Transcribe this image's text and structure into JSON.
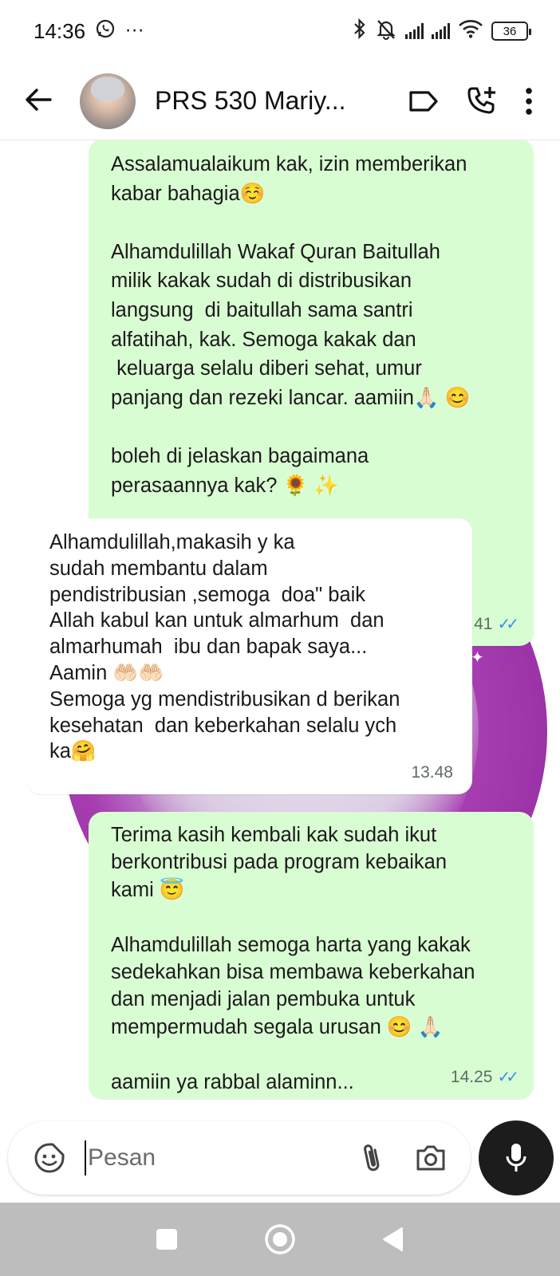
{
  "status_bar": {
    "time": "14:36",
    "notification_icons": [
      "whatsapp-icon",
      "more-dots"
    ],
    "more_dots": "···",
    "battery": "36"
  },
  "header": {
    "contact_name": "PRS 530 Mariy...",
    "icons": [
      "back-arrow-icon",
      "label-icon",
      "add-call-icon",
      "overflow-menu-icon"
    ]
  },
  "messages": [
    {
      "direction": "outgoing",
      "text": "Assalamualaikum kak, izin memberikan\nkabar bahagia☺️\n\nAlhamdulillah Wakaf Quran Baitullah\nmilik kakak sudah di distribusikan\nlangsung  di baitullah sama santri\nalfatihah, kak. Semoga kakak dan\n keluarga selalu diberi sehat, umur\npanjang dan rezeki lancar. aamiin🙏🏻 😊\n\nboleh di jelaskan bagaimana\nperasaannya kak? 🌻 ✨",
      "time": "13.41",
      "status": "read"
    },
    {
      "direction": "incoming",
      "text": "Alhamdulillah,makasih y ka\nsudah membantu dalam\npendistribusian ,semoga  doa\" baik\nAllah kabul kan untuk almarhum  dan\nalmarhumah  ibu dan bapak saya...\nAamin 🤲🏻🤲🏻\nSemoga yg mendistribusikan d berikan\nkesehatan  dan keberkahan selalu ych\nka🤗",
      "time": "13.48"
    },
    {
      "direction": "outgoing",
      "text": "Terima kasih kembali kak sudah ikut\nberkontribusi pada program kebaikan\nkami 😇\n\nAlhamdulillah semoga harta yang kakak\nsedekahkan bisa membawa keberkahan\ndan menjadi jalan pembuka untuk\nmempermudah segala urusan 😊 🙏🏻\n\naamiin ya rabbal alaminn...",
      "time": "14.25",
      "status": "read"
    }
  ],
  "composer": {
    "placeholder": "Pesan",
    "icons": [
      "sticker-icon",
      "attach-icon",
      "camera-icon",
      "mic-icon"
    ]
  },
  "colors": {
    "outgoing_bubble": "#d9fdd3",
    "incoming_bubble": "#ffffff",
    "read_ticks": "#3b8fe4",
    "wallpaper_accent": "#a63db0",
    "nav_bar": "#bdbdbd"
  },
  "nav_bar": {
    "icons": [
      "recents-square-icon",
      "home-circle-icon",
      "back-triangle-icon"
    ]
  }
}
